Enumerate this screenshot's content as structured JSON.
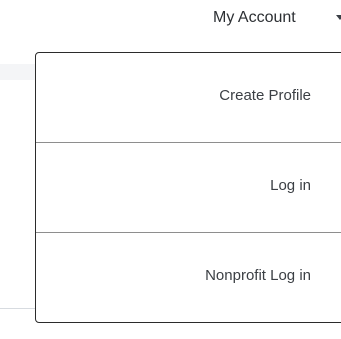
{
  "header": {
    "account_label": "My Account",
    "chevron_icon": "chevron-down-icon"
  },
  "dropdown": {
    "items": [
      {
        "label": "Create Profile"
      },
      {
        "label": "Log in"
      },
      {
        "label": "Nonprofit Log in"
      }
    ]
  }
}
